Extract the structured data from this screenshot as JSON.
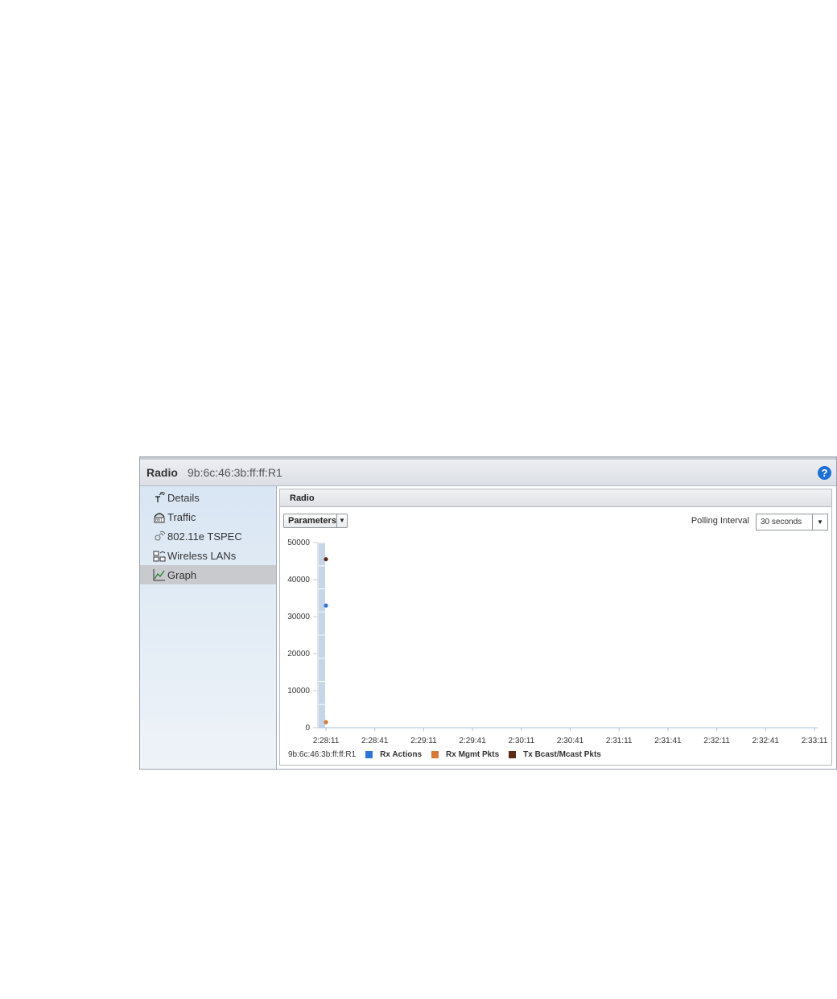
{
  "header": {
    "title": "Radio",
    "subtitle": "9b:6c:46:3b:ff:ff:R1",
    "help": "?"
  },
  "sidebar": {
    "items": [
      {
        "label": "Details",
        "icon": "radio-antenna-icon"
      },
      {
        "label": "Traffic",
        "icon": "traffic-meter-icon"
      },
      {
        "label": "802.11e TSPEC",
        "icon": "wireless-qos-icon"
      },
      {
        "label": "Wireless LANs",
        "icon": "wlan-icon"
      },
      {
        "label": "Graph",
        "icon": "graph-icon",
        "active": true
      }
    ]
  },
  "panel": {
    "title": "Radio",
    "parameters_label": "Parameters",
    "polling_label": "Polling Interval",
    "polling_value": "30 seconds"
  },
  "chart_data": {
    "type": "scatter",
    "x_ticks": [
      "2:28:11",
      "2:28:41",
      "2:29:11",
      "2:29:41",
      "2:30:11",
      "2:30:41",
      "2:31:11",
      "2:31:41",
      "2:32:11",
      "2:32:41",
      "2:33:11"
    ],
    "y_ticks": [
      0,
      10000,
      20000,
      30000,
      40000,
      50000
    ],
    "ylim": [
      0,
      50000
    ],
    "series": [
      {
        "name": "Rx Actions",
        "color": "#2f73d6",
        "points": [
          {
            "x": "2:28:11",
            "y": 33000
          }
        ]
      },
      {
        "name": "Rx Mgmt Pkts",
        "color": "#d77a35",
        "points": [
          {
            "x": "2:28:11",
            "y": 1500
          }
        ]
      },
      {
        "name": "Tx Bcast/Mcast Pkts",
        "color": "#5e2a16",
        "points": [
          {
            "x": "2:28:11",
            "y": 45500
          }
        ]
      }
    ],
    "legend_host": "9b:6c:46:3b:ff:ff:R1",
    "highlight_column": "2:28:11"
  }
}
